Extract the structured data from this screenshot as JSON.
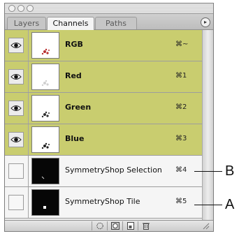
{
  "tabs": [
    {
      "label": "Layers",
      "active": false
    },
    {
      "label": "Channels",
      "active": true
    },
    {
      "label": "Paths",
      "active": false
    }
  ],
  "channels": [
    {
      "name": "RGB",
      "shortcut": "⌘~",
      "visible": true,
      "kind": "color",
      "thumb_color": "#b83030"
    },
    {
      "name": "Red",
      "shortcut": "⌘1",
      "visible": true,
      "kind": "color",
      "thumb_color": "#d0d0d0"
    },
    {
      "name": "Green",
      "shortcut": "⌘2",
      "visible": true,
      "kind": "color",
      "thumb_color": "#303030"
    },
    {
      "name": "Blue",
      "shortcut": "⌘3",
      "visible": true,
      "kind": "color",
      "thumb_color": "#202020"
    },
    {
      "name": "SymmetryShop Selection",
      "shortcut": "⌘4",
      "visible": false,
      "kind": "alpha"
    },
    {
      "name": "SymmetryShop Tile",
      "shortcut": "⌘5",
      "visible": false,
      "kind": "alpha"
    }
  ],
  "callouts": [
    {
      "label": "B",
      "channel": "SymmetryShop Selection"
    },
    {
      "label": "A",
      "channel": "SymmetryShop Tile"
    }
  ],
  "bottom_buttons": [
    "load-selection-icon",
    "save-selection-icon",
    "new-channel-icon",
    "trash-icon"
  ],
  "colors": {
    "color_channel_highlight": "#c9cd6f",
    "alpha_row_bg": "#f5f5f5"
  }
}
